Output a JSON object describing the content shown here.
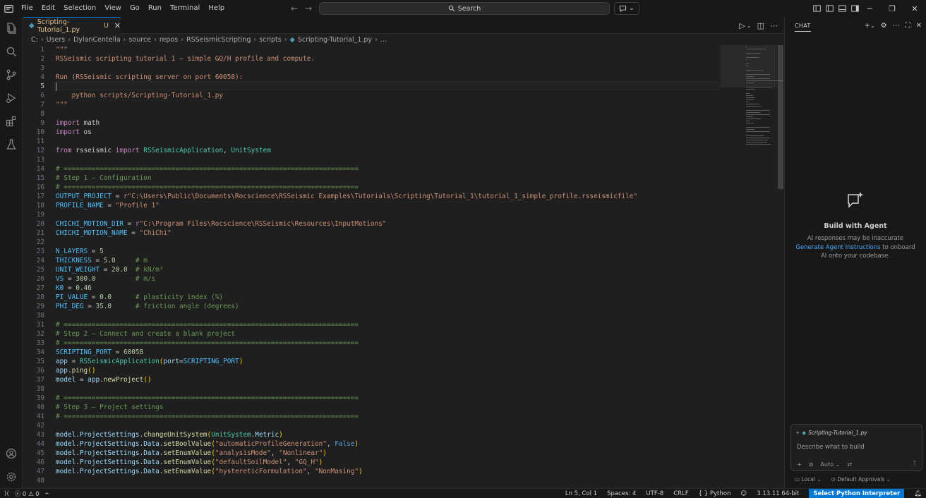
{
  "titlebar": {
    "menu": [
      "File",
      "Edit",
      "Selection",
      "View",
      "Go",
      "Run",
      "Terminal",
      "Help"
    ],
    "search_label": "Search"
  },
  "tab": {
    "label": "Scripting-Tutorial_1.py",
    "status": "U"
  },
  "breadcrumbs": [
    "C:",
    "Users",
    "DylanCentella",
    "source",
    "repos",
    "RSSeismicScripting",
    "scripts",
    "Scripting-Tutorial_1.py",
    "..."
  ],
  "editor": {
    "active_line": 5,
    "lines": [
      [
        [
          "\"\"\"",
          "str"
        ]
      ],
      [
        [
          "RSSeismic scripting tutorial 1 — simple GQ/H profile and compute.",
          "str"
        ]
      ],
      [],
      [
        [
          "Run (RSSeismic scripting server on port 60058):",
          "str"
        ]
      ],
      [
        [
          "",
          "caret"
        ]
      ],
      [
        [
          "    python scripts/Scripting-Tutorial_1.py",
          "str"
        ]
      ],
      [
        [
          "\"\"\"",
          "str"
        ]
      ],
      [],
      [
        [
          "import",
          "kw"
        ],
        [
          " math",
          "plain"
        ]
      ],
      [
        [
          "import",
          "kw"
        ],
        [
          " os",
          "plain"
        ]
      ],
      [],
      [
        [
          "from",
          "kw"
        ],
        [
          " rsseismic ",
          "plain"
        ],
        [
          "import",
          "kw"
        ],
        [
          " ",
          "plain"
        ],
        [
          "RSSeismicApplication",
          "cls"
        ],
        [
          ", ",
          "plain"
        ],
        [
          "UnitSystem",
          "cls"
        ]
      ],
      [],
      [
        [
          "# ==========================================================================",
          "cmt"
        ]
      ],
      [
        [
          "# Step 1 — Configuration",
          "cmt"
        ]
      ],
      [
        [
          "# ==========================================================================",
          "cmt"
        ]
      ],
      [
        [
          "OUTPUT_PROJECT",
          "const"
        ],
        [
          " = ",
          "plain"
        ],
        [
          "r",
          "kw"
        ],
        [
          "\"C:",
          "str"
        ],
        [
          "\\Users\\Public\\Documents\\Rocscience\\RSSeismic Examples\\Tutorials\\Scripting\\Tutorial_1\\tutorial_1_simple_profile.rsseismicfile\"",
          "str"
        ]
      ],
      [
        [
          "PROFILE_NAME",
          "const"
        ],
        [
          " = ",
          "plain"
        ],
        [
          "\"Profile 1\"",
          "str"
        ]
      ],
      [],
      [
        [
          "CHICHI_MOTION_DIR",
          "const"
        ],
        [
          " = ",
          "plain"
        ],
        [
          "r",
          "kw"
        ],
        [
          "\"C:\\Program Files\\Rocscience\\RSSeismic\\Resources\\InputMotions\"",
          "str"
        ]
      ],
      [
        [
          "CHICHI_MOTION_NAME",
          "const"
        ],
        [
          " = ",
          "plain"
        ],
        [
          "\"ChiChi\"",
          "str"
        ]
      ],
      [],
      [
        [
          "N_LAYERS",
          "const"
        ],
        [
          " = ",
          "plain"
        ],
        [
          "5",
          "num"
        ]
      ],
      [
        [
          "THICKNESS",
          "const"
        ],
        [
          " = ",
          "plain"
        ],
        [
          "5.0",
          "num"
        ],
        [
          "     ",
          "plain"
        ],
        [
          "# m",
          "cmt"
        ]
      ],
      [
        [
          "UNIT_WEIGHT",
          "const"
        ],
        [
          " = ",
          "plain"
        ],
        [
          "20.0",
          "num"
        ],
        [
          "  ",
          "plain"
        ],
        [
          "# kN/m³",
          "cmt"
        ]
      ],
      [
        [
          "VS",
          "const"
        ],
        [
          " = ",
          "plain"
        ],
        [
          "300.0",
          "num"
        ],
        [
          "          ",
          "plain"
        ],
        [
          "# m/s",
          "cmt"
        ]
      ],
      [
        [
          "K0",
          "const"
        ],
        [
          " = ",
          "plain"
        ],
        [
          "0.46",
          "num"
        ]
      ],
      [
        [
          "PI_VALUE",
          "const"
        ],
        [
          " = ",
          "plain"
        ],
        [
          "0.0",
          "num"
        ],
        [
          "      ",
          "plain"
        ],
        [
          "# plasticity index (%)",
          "cmt"
        ]
      ],
      [
        [
          "PHI_DEG",
          "const"
        ],
        [
          " = ",
          "plain"
        ],
        [
          "35.0",
          "num"
        ],
        [
          "      ",
          "plain"
        ],
        [
          "# friction angle (degrees)",
          "cmt"
        ]
      ],
      [],
      [
        [
          "# ==========================================================================",
          "cmt"
        ]
      ],
      [
        [
          "# Step 2 — Connect and create a blank project",
          "cmt"
        ]
      ],
      [
        [
          "# ==========================================================================",
          "cmt"
        ]
      ],
      [
        [
          "SCRIPTING_PORT",
          "const"
        ],
        [
          " = ",
          "plain"
        ],
        [
          "60058",
          "num"
        ]
      ],
      [
        [
          "app",
          "var"
        ],
        [
          " = ",
          "plain"
        ],
        [
          "RSSeismicApplication",
          "cls"
        ],
        [
          "(",
          "br"
        ],
        [
          "port",
          "var"
        ],
        [
          "=",
          "plain"
        ],
        [
          "SCRIPTING_PORT",
          "const"
        ],
        [
          ")",
          "br"
        ]
      ],
      [
        [
          "app",
          "var"
        ],
        [
          ".",
          "plain"
        ],
        [
          "ping",
          "fn"
        ],
        [
          "()",
          "br"
        ]
      ],
      [
        [
          "model",
          "var"
        ],
        [
          " = ",
          "plain"
        ],
        [
          "app",
          "var"
        ],
        [
          ".",
          "plain"
        ],
        [
          "newProject",
          "fn"
        ],
        [
          "()",
          "br"
        ]
      ],
      [],
      [
        [
          "# ==========================================================================",
          "cmt"
        ]
      ],
      [
        [
          "# Step 3 — Project settings",
          "cmt"
        ]
      ],
      [
        [
          "# ==========================================================================",
          "cmt"
        ]
      ],
      [],
      [
        [
          "model",
          "var"
        ],
        [
          ".",
          "plain"
        ],
        [
          "ProjectSettings",
          "var"
        ],
        [
          ".",
          "plain"
        ],
        [
          "changeUnitSystem",
          "fn"
        ],
        [
          "(",
          "br"
        ],
        [
          "UnitSystem",
          "cls"
        ],
        [
          ".",
          "plain"
        ],
        [
          "Metric",
          "var"
        ],
        [
          ")",
          "br"
        ]
      ],
      [
        [
          "model",
          "var"
        ],
        [
          ".",
          "plain"
        ],
        [
          "ProjectSettings",
          "var"
        ],
        [
          ".",
          "plain"
        ],
        [
          "Data",
          "var"
        ],
        [
          ".",
          "plain"
        ],
        [
          "setBoolValue",
          "fn"
        ],
        [
          "(",
          "br"
        ],
        [
          "\"automaticProfileGeneration\"",
          "str"
        ],
        [
          ", ",
          "plain"
        ],
        [
          "False",
          "bool"
        ],
        [
          ")",
          "br"
        ]
      ],
      [
        [
          "model",
          "var"
        ],
        [
          ".",
          "plain"
        ],
        [
          "ProjectSettings",
          "var"
        ],
        [
          ".",
          "plain"
        ],
        [
          "Data",
          "var"
        ],
        [
          ".",
          "plain"
        ],
        [
          "setEnumValue",
          "fn"
        ],
        [
          "(",
          "br"
        ],
        [
          "\"analysisMode\"",
          "str"
        ],
        [
          ", ",
          "plain"
        ],
        [
          "\"Nonlinear\"",
          "str"
        ],
        [
          ")",
          "br"
        ]
      ],
      [
        [
          "model",
          "var"
        ],
        [
          ".",
          "plain"
        ],
        [
          "ProjectSettings",
          "var"
        ],
        [
          ".",
          "plain"
        ],
        [
          "Data",
          "var"
        ],
        [
          ".",
          "plain"
        ],
        [
          "setEnumValue",
          "fn"
        ],
        [
          "(",
          "br"
        ],
        [
          "\"defaultSoilModel\"",
          "str"
        ],
        [
          ", ",
          "plain"
        ],
        [
          "\"GQ_H\"",
          "str"
        ],
        [
          ")",
          "br"
        ]
      ],
      [
        [
          "model",
          "var"
        ],
        [
          ".",
          "plain"
        ],
        [
          "ProjectSettings",
          "var"
        ],
        [
          ".",
          "plain"
        ],
        [
          "Data",
          "var"
        ],
        [
          ".",
          "plain"
        ],
        [
          "setEnumValue",
          "fn"
        ],
        [
          "(",
          "br"
        ],
        [
          "\"hystereticFormulation\"",
          "str"
        ],
        [
          ", ",
          "plain"
        ],
        [
          "\"NonMasing\"",
          "str"
        ],
        [
          ")",
          "br"
        ]
      ],
      []
    ]
  },
  "chat": {
    "title": "CHAT",
    "empty_title": "Build with Agent",
    "empty_note_1": "AI responses may be inaccurate",
    "empty_link": "Generate Agent Instructions",
    "empty_note_2": " to onboard AI onto your codebase.",
    "context_file": "Scripting-Tutorial_1.py",
    "input_placeholder": "Describe what to build",
    "mode_label": "Auto",
    "location_label": "Local",
    "approvals_label": "Default Approvals"
  },
  "statusbar": {
    "errors": "0",
    "warnings": "0",
    "cursor": "Ln 5, Col 1",
    "spaces": "Spaces: 4",
    "encoding": "UTF-8",
    "eol": "CRLF",
    "language": "Python",
    "python_version": "3.13.11 64-bit",
    "interpreter_button": "Select Python Interpreter"
  }
}
